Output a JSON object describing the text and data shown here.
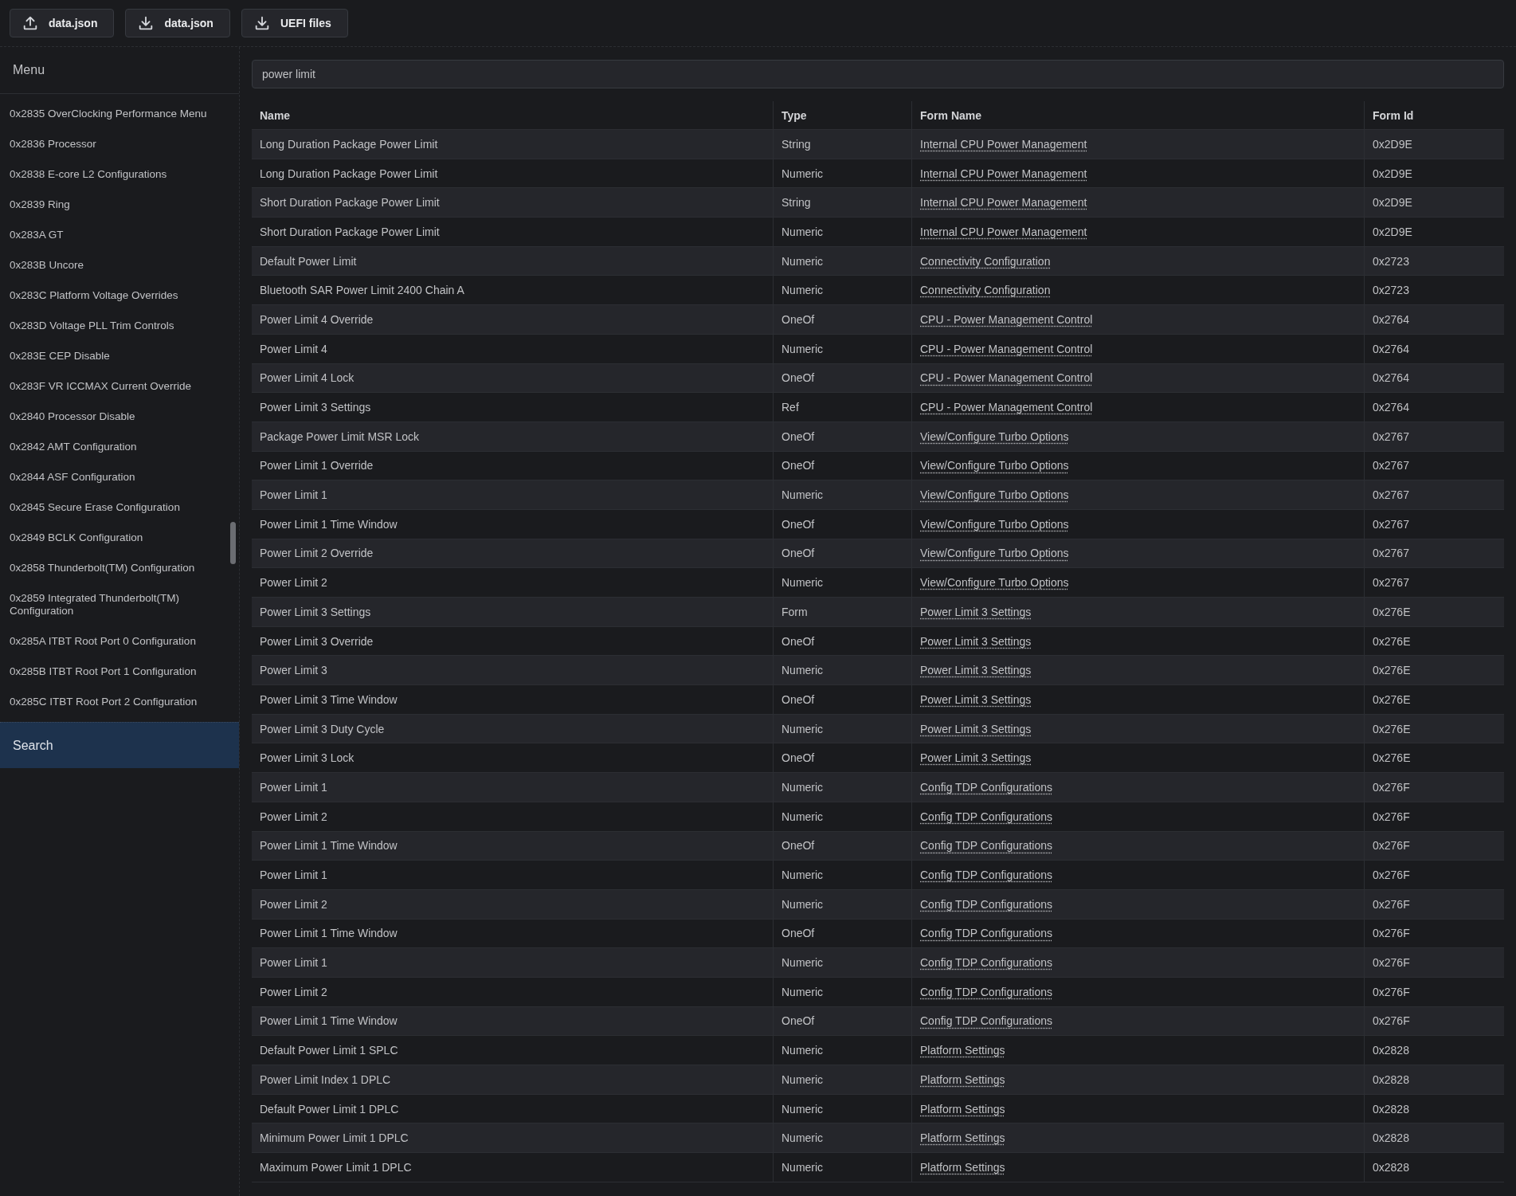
{
  "toolbar": [
    {
      "kind": "upload",
      "label": "data.json"
    },
    {
      "kind": "download",
      "label": "data.json"
    },
    {
      "kind": "download",
      "label": "UEFI files"
    }
  ],
  "sidebar": {
    "title": "Menu",
    "items": [
      {
        "label": "0x2835 OverClocking Performance Menu"
      },
      {
        "label": "0x2836 Processor"
      },
      {
        "label": "0x2838 E-core L2 Configurations"
      },
      {
        "label": "0x2839 Ring"
      },
      {
        "label": "0x283A GT"
      },
      {
        "label": "0x283B Uncore"
      },
      {
        "label": "0x283C Platform Voltage Overrides"
      },
      {
        "label": "0x283D Voltage PLL Trim Controls"
      },
      {
        "label": "0x283E CEP Disable"
      },
      {
        "label": "0x283F VR ICCMAX Current Override"
      },
      {
        "label": "0x2840 Processor Disable"
      },
      {
        "label": "0x2842 AMT Configuration"
      },
      {
        "label": "0x2844 ASF Configuration"
      },
      {
        "label": "0x2845 Secure Erase Configuration"
      },
      {
        "label": "0x2849 BCLK Configuration"
      },
      {
        "label": "0x2858 Thunderbolt(TM) Configuration"
      },
      {
        "label": "0x2859 Integrated Thunderbolt(TM) Configuration"
      },
      {
        "label": "0x285A ITBT Root Port 0 Configuration"
      },
      {
        "label": "0x285B ITBT Root Port 1 Configuration"
      },
      {
        "label": "0x285C ITBT Root Port 2 Configuration"
      }
    ],
    "nav_items": [
      {
        "label": "Search",
        "selected": true
      }
    ]
  },
  "search": {
    "value": "power limit"
  },
  "table": {
    "columns": [
      "Name",
      "Type",
      "Form Name",
      "Form Id"
    ],
    "rows": [
      [
        "Long Duration Package Power Limit",
        "String",
        "Internal CPU Power Management",
        "0x2D9E"
      ],
      [
        "Long Duration Package Power Limit",
        "Numeric",
        "Internal CPU Power Management",
        "0x2D9E"
      ],
      [
        "Short Duration Package Power Limit",
        "String",
        "Internal CPU Power Management",
        "0x2D9E"
      ],
      [
        "Short Duration Package Power Limit",
        "Numeric",
        "Internal CPU Power Management",
        "0x2D9E"
      ],
      [
        "Default Power Limit",
        "Numeric",
        "Connectivity Configuration",
        "0x2723"
      ],
      [
        "Bluetooth SAR Power Limit 2400 Chain A",
        "Numeric",
        "Connectivity Configuration",
        "0x2723"
      ],
      [
        "Power Limit 4 Override",
        "OneOf",
        "CPU - Power Management Control",
        "0x2764"
      ],
      [
        "Power Limit 4",
        "Numeric",
        "CPU - Power Management Control",
        "0x2764"
      ],
      [
        "Power Limit 4 Lock",
        "OneOf",
        "CPU - Power Management Control",
        "0x2764"
      ],
      [
        "Power Limit 3 Settings",
        "Ref",
        "CPU - Power Management Control",
        "0x2764"
      ],
      [
        "Package Power Limit MSR Lock",
        "OneOf",
        "View/Configure Turbo Options",
        "0x2767"
      ],
      [
        "Power Limit 1 Override",
        "OneOf",
        "View/Configure Turbo Options",
        "0x2767"
      ],
      [
        "Power Limit 1",
        "Numeric",
        "View/Configure Turbo Options",
        "0x2767"
      ],
      [
        "Power Limit 1 Time Window",
        "OneOf",
        "View/Configure Turbo Options",
        "0x2767"
      ],
      [
        "Power Limit 2 Override",
        "OneOf",
        "View/Configure Turbo Options",
        "0x2767"
      ],
      [
        "Power Limit 2",
        "Numeric",
        "View/Configure Turbo Options",
        "0x2767"
      ],
      [
        "Power Limit 3 Settings",
        "Form",
        "Power Limit 3 Settings",
        "0x276E"
      ],
      [
        "Power Limit 3 Override",
        "OneOf",
        "Power Limit 3 Settings",
        "0x276E"
      ],
      [
        "Power Limit 3",
        "Numeric",
        "Power Limit 3 Settings",
        "0x276E"
      ],
      [
        "Power Limit 3 Time Window",
        "OneOf",
        "Power Limit 3 Settings",
        "0x276E"
      ],
      [
        "Power Limit 3 Duty Cycle",
        "Numeric",
        "Power Limit 3 Settings",
        "0x276E"
      ],
      [
        "Power Limit 3 Lock",
        "OneOf",
        "Power Limit 3 Settings",
        "0x276E"
      ],
      [
        "Power Limit 1",
        "Numeric",
        "Config TDP Configurations",
        "0x276F"
      ],
      [
        "Power Limit 2",
        "Numeric",
        "Config TDP Configurations",
        "0x276F"
      ],
      [
        "Power Limit 1 Time Window",
        "OneOf",
        "Config TDP Configurations",
        "0x276F"
      ],
      [
        "Power Limit 1",
        "Numeric",
        "Config TDP Configurations",
        "0x276F"
      ],
      [
        "Power Limit 2",
        "Numeric",
        "Config TDP Configurations",
        "0x276F"
      ],
      [
        "Power Limit 1 Time Window",
        "OneOf",
        "Config TDP Configurations",
        "0x276F"
      ],
      [
        "Power Limit 1",
        "Numeric",
        "Config TDP Configurations",
        "0x276F"
      ],
      [
        "Power Limit 2",
        "Numeric",
        "Config TDP Configurations",
        "0x276F"
      ],
      [
        "Power Limit 1 Time Window",
        "OneOf",
        "Config TDP Configurations",
        "0x276F"
      ],
      [
        "Default Power Limit 1 SPLC",
        "Numeric",
        "Platform Settings",
        "0x2828"
      ],
      [
        "Power Limit Index 1 DPLC",
        "Numeric",
        "Platform Settings",
        "0x2828"
      ],
      [
        "Default Power Limit 1 DPLC",
        "Numeric",
        "Platform Settings",
        "0x2828"
      ],
      [
        "Minimum Power Limit 1 DPLC",
        "Numeric",
        "Platform Settings",
        "0x2828"
      ],
      [
        "Maximum Power Limit 1 DPLC",
        "Numeric",
        "Platform Settings",
        "0x2828"
      ]
    ]
  }
}
